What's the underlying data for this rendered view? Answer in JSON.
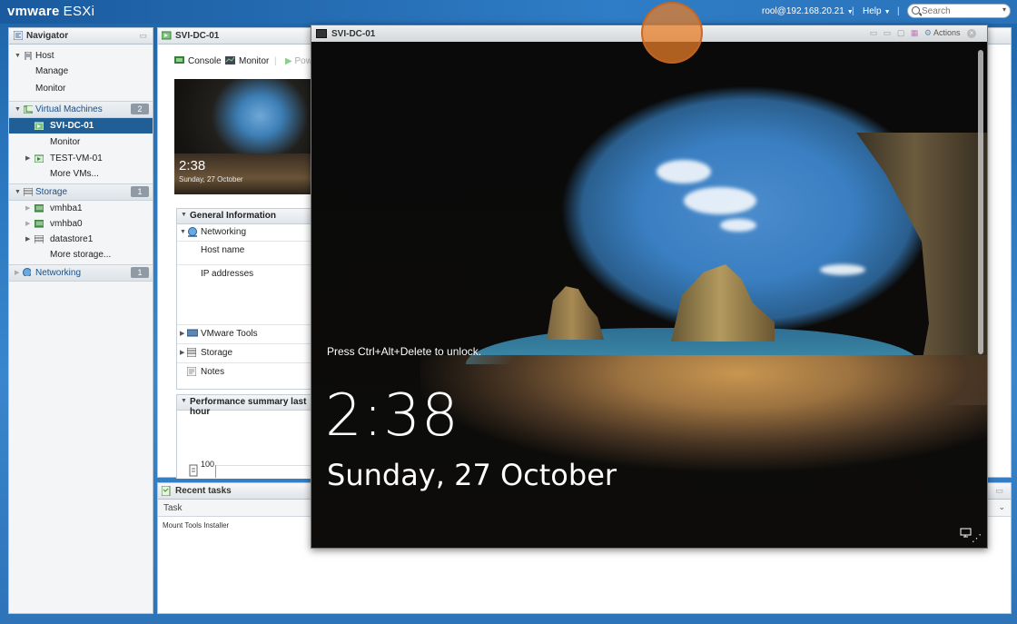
{
  "topbar": {
    "brand": "vmware",
    "product": "ESXi",
    "user": "rool@192.168.20.21",
    "help": "Help",
    "search_placeholder": "Search"
  },
  "navigator": {
    "title": "Navigator",
    "host": {
      "label": "Host",
      "children": [
        "Manage",
        "Monitor"
      ]
    },
    "virtual_machines": {
      "label": "Virtual Machines",
      "count": "2",
      "selected": "SVI-DC-01",
      "selected_children": [
        "Monitor"
      ],
      "other": "TEST-VM-01",
      "more": "More VMs..."
    },
    "storage": {
      "label": "Storage",
      "count": "1",
      "items": [
        "vmhba1",
        "vmhba0",
        "datastore1"
      ],
      "more": "More storage..."
    },
    "networking": {
      "label": "Networking",
      "count": "1"
    }
  },
  "vm_panel": {
    "title": "SVI-DC-01",
    "toolbar": {
      "console": "Console",
      "monitor": "Monitor",
      "power": "Pow"
    },
    "thumbnail": {
      "time": "2:38",
      "date": "Sunday, 27 October"
    },
    "general_info": {
      "title": "General Information",
      "networking": "Networking",
      "host_name": "Host name",
      "ip_addresses": "IP addresses",
      "vmware_tools": "VMware Tools",
      "storage": "Storage",
      "notes": "Notes"
    },
    "performance": {
      "title": "Performance summary last hour",
      "axis_value": "100"
    }
  },
  "recent_tasks": {
    "title": "Recent tasks",
    "column": "Task",
    "rows": [
      "Mount Tools Installer"
    ]
  },
  "console_window": {
    "title": "SVI-DC-01",
    "actions": "Actions",
    "lock_message": "Press Ctrl+Alt+Delete to unlock.",
    "time": "2:38",
    "date": "Sunday, 27 October"
  },
  "colors": {
    "accent": "#1f5f96",
    "cursor_highlight": "#e67e28"
  }
}
